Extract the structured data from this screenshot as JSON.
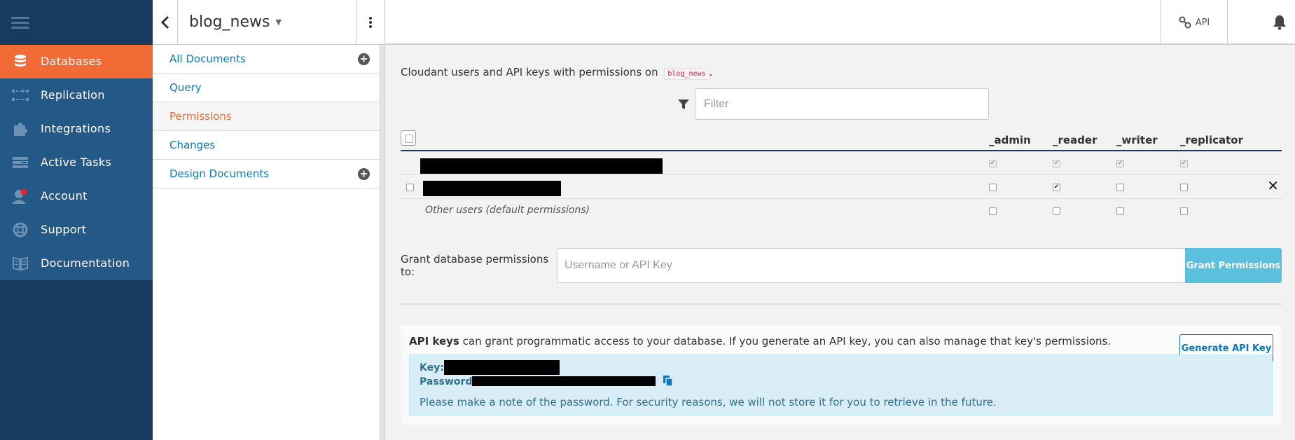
{
  "nav": {
    "items": [
      {
        "label": "Databases",
        "icon": "database-icon",
        "active": true
      },
      {
        "label": "Replication",
        "icon": "replication-icon",
        "active": false
      },
      {
        "label": "Integrations",
        "icon": "puzzle-icon",
        "active": false
      },
      {
        "label": "Active Tasks",
        "icon": "tasks-icon",
        "active": false
      },
      {
        "label": "Account",
        "icon": "account-icon",
        "active": false
      },
      {
        "label": "Support",
        "icon": "lifebuoy-icon",
        "active": false
      },
      {
        "label": "Documentation",
        "icon": "book-icon",
        "active": false
      }
    ]
  },
  "db": {
    "name": "blog_news",
    "caret": "▼",
    "menu": [
      {
        "label": "All Documents",
        "has_add": true,
        "active": false
      },
      {
        "label": "Query",
        "has_add": false,
        "active": false
      },
      {
        "label": "Permissions",
        "has_add": false,
        "active": true
      },
      {
        "label": "Changes",
        "has_add": false,
        "active": false
      },
      {
        "label": "Design Documents",
        "has_add": true,
        "active": false
      }
    ]
  },
  "topbar": {
    "api_label": "API"
  },
  "permissions": {
    "intro_text": "Cloudant users and API keys with permissions on",
    "intro_db": "blog_news",
    "intro_end": ".",
    "filter_placeholder": "Filter",
    "roles": [
      "_admin",
      "_reader",
      "_writer",
      "_replicator"
    ],
    "rows": [
      {
        "type": "redacted",
        "checks": [
          true,
          true,
          true,
          true
        ],
        "disabled": true,
        "removable": false
      },
      {
        "type": "redacted",
        "checks": [
          false,
          true,
          false,
          false
        ],
        "disabled": false,
        "removable": true
      },
      {
        "type": "other",
        "label": "Other users (default permissions)",
        "checks": [
          false,
          false,
          false,
          false
        ],
        "disabled": false,
        "removable": false
      }
    ],
    "remove_symbol": "✕"
  },
  "grant": {
    "label": "Grant database permissions to:",
    "placeholder": "Username or API Key",
    "button": "Grant Permissions"
  },
  "apikeys": {
    "bold": "API keys",
    "desc": " can grant programmatic access to your database. If you generate an API key, you can also manage that key's permissions.",
    "generate_button": "Generate API Key",
    "key_label": "Key:",
    "password_label": "Password:",
    "note": "Please make a note of the password. For security reasons, we will not store it for you to retrieve in the future."
  },
  "colors": {
    "nav_bg": "#183a5d",
    "nav_item": "#235887",
    "accent": "#f26a35",
    "link": "#0a79c2",
    "info_bg": "#d9edf7",
    "grant_btn": "#5bc0de"
  }
}
